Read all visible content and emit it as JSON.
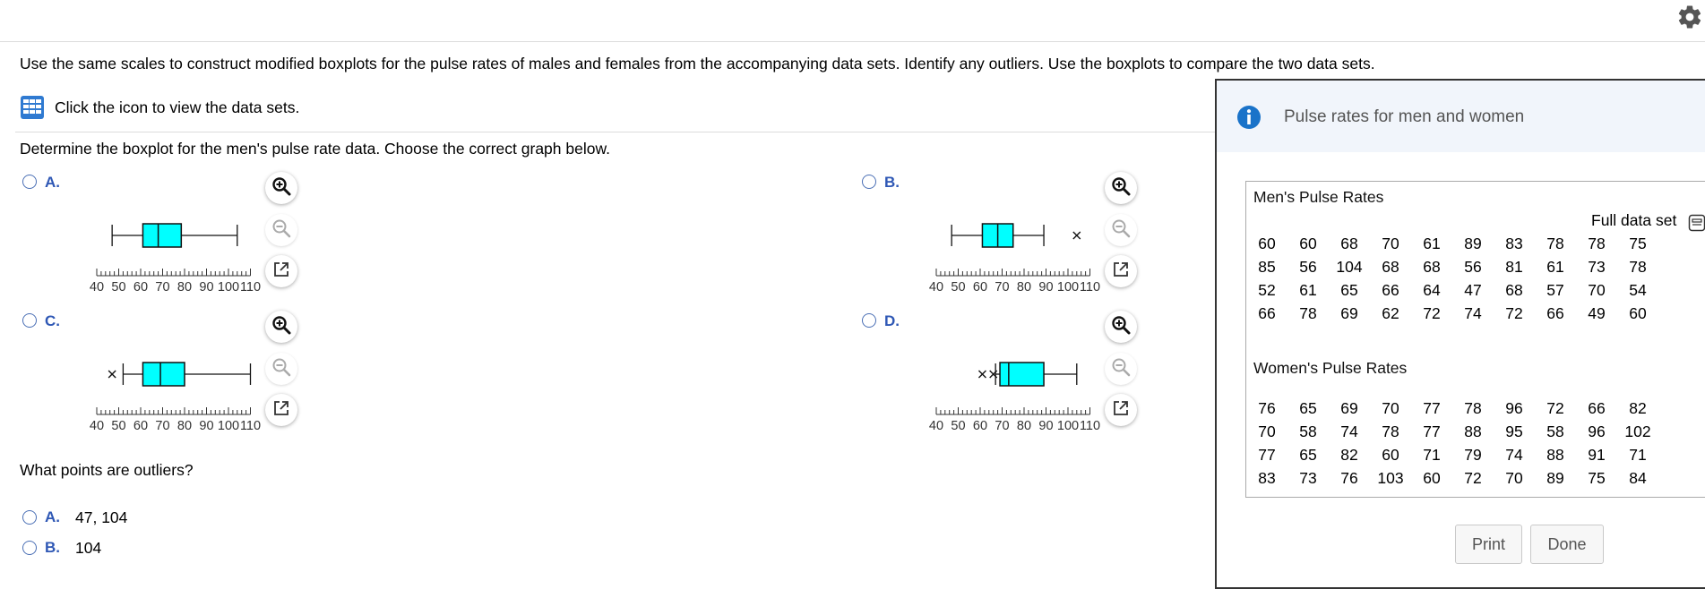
{
  "prompt": "Use the same scales to construct modified boxplots for the pulse rates of males and females from the accompanying data sets. Identify any outliers. Use the boxplots to compare the two data sets.",
  "data_link_text": "Click the icon to view the data sets.",
  "question": "Determine the boxplot for the men's pulse rate data. Choose the correct graph below.",
  "axis_ticks": [
    "40",
    "50",
    "60",
    "70",
    "80",
    "90",
    "100",
    "110"
  ],
  "options": [
    {
      "label": "A.",
      "boxplot": {
        "whisker_low": 47,
        "q1": 61,
        "median": 68,
        "q3": 78.5,
        "whisker_high": 104,
        "outliers": []
      }
    },
    {
      "label": "B.",
      "boxplot": {
        "whisker_low": 47,
        "q1": 61,
        "median": 68,
        "q3": 75,
        "whisker_high": 89,
        "outliers": [
          104
        ]
      }
    },
    {
      "label": "C.",
      "boxplot": {
        "whisker_low": 52,
        "q1": 61,
        "median": 69,
        "q3": 80,
        "whisker_high": 110,
        "outliers": [
          47
        ]
      }
    },
    {
      "label": "D.",
      "boxplot": {
        "whisker_low": 67,
        "q1": 69,
        "median": 73,
        "q3": 89,
        "whisker_high": 104,
        "outliers": [
          61,
          66
        ]
      }
    }
  ],
  "zoom_icons": {
    "zoom_in": "zoom-in-icon",
    "zoom_out": "zoom-out-icon",
    "popout": "popout-icon"
  },
  "outlier_question": "What points are outliers?",
  "answers": [
    {
      "label": "A.",
      "value": "47, 104"
    },
    {
      "label": "B.",
      "value": "104"
    }
  ],
  "popup": {
    "title": "Pulse rates for men and women",
    "men_title": "Men's Pulse Rates",
    "full_data_set": "Full data set",
    "men_rows": [
      [
        "60",
        "60",
        "68",
        "70",
        "61",
        "89",
        "83",
        "78",
        "78",
        "75"
      ],
      [
        "85",
        "56",
        "104",
        "68",
        "68",
        "56",
        "81",
        "61",
        "73",
        "78"
      ],
      [
        "52",
        "61",
        "65",
        "66",
        "64",
        "47",
        "68",
        "57",
        "70",
        "54"
      ],
      [
        "66",
        "78",
        "69",
        "62",
        "72",
        "74",
        "72",
        "66",
        "49",
        "60"
      ]
    ],
    "women_title": "Women's Pulse Rates",
    "women_rows": [
      [
        "76",
        "65",
        "69",
        "70",
        "77",
        "78",
        "96",
        "72",
        "66",
        "82"
      ],
      [
        "70",
        "58",
        "74",
        "78",
        "77",
        "88",
        "95",
        "58",
        "96",
        "102"
      ],
      [
        "77",
        "65",
        "82",
        "60",
        "71",
        "79",
        "74",
        "88",
        "91",
        "71"
      ],
      [
        "83",
        "73",
        "76",
        "103",
        "60",
        "72",
        "70",
        "89",
        "75",
        "84"
      ]
    ],
    "print_label": "Print",
    "done_label": "Done"
  },
  "colors": {
    "box_fill": "#00ffff",
    "accent": "#2f58b5",
    "info": "#1a73c9"
  }
}
